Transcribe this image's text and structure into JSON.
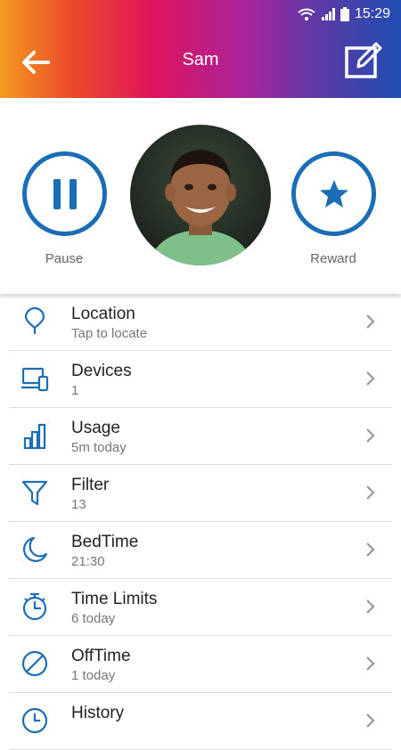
{
  "status": {
    "time": "15:29"
  },
  "header": {
    "title": "Sam"
  },
  "hero": {
    "pause_label": "Pause",
    "reward_label": "Reward"
  },
  "colors": {
    "accent": "#1b6db5",
    "header_gradient": [
      "#f39c1f",
      "#e0135c",
      "#a4259e",
      "#1f4db0"
    ]
  },
  "menu": [
    {
      "label": "Location",
      "sub": "Tap to locate",
      "icon": "location-pin-icon"
    },
    {
      "label": "Devices",
      "sub": "1",
      "icon": "devices-icon"
    },
    {
      "label": "Usage",
      "sub": "5m today",
      "icon": "bar-chart-icon"
    },
    {
      "label": "Filter",
      "sub": "13",
      "icon": "filter-icon"
    },
    {
      "label": "BedTime",
      "sub": "21:30",
      "icon": "moon-icon"
    },
    {
      "label": "Time Limits",
      "sub": "6 today",
      "icon": "stopwatch-icon"
    },
    {
      "label": "OffTime",
      "sub": "1 today",
      "icon": "block-icon"
    },
    {
      "label": "History",
      "sub": "",
      "icon": "clock-icon"
    }
  ]
}
